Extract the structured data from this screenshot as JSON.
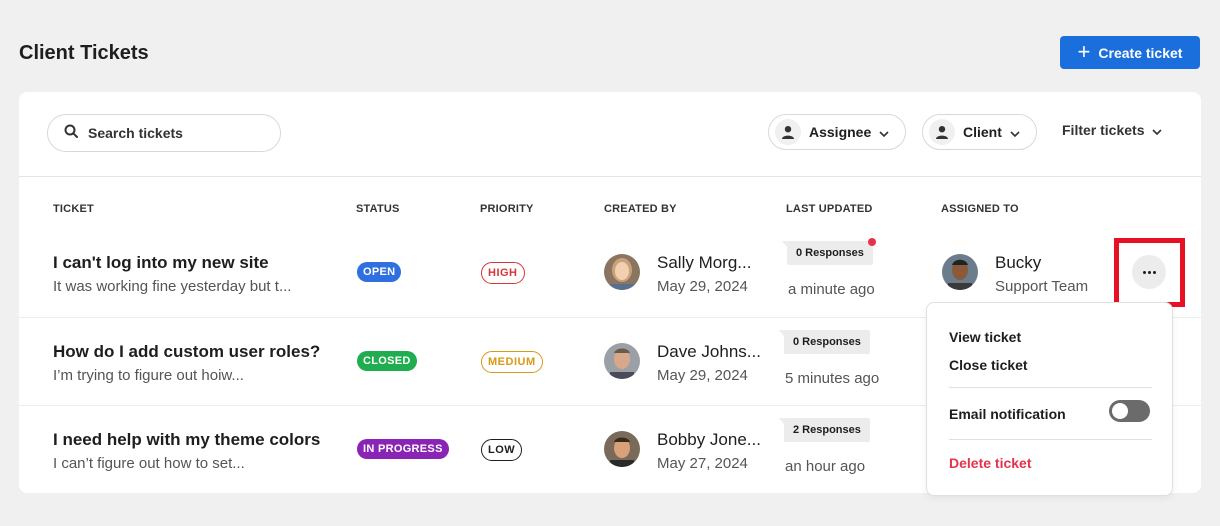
{
  "page": {
    "title": "Client Tickets",
    "create_label": "Create ticket"
  },
  "toolbar": {
    "search_placeholder": "Search tickets",
    "assignee_label": "Assignee",
    "client_label": "Client",
    "filter_label": "Filter tickets"
  },
  "columns": [
    "TICKET",
    "STATUS",
    "PRIORITY",
    "CREATED BY",
    "LAST UPDATED",
    "ASSIGNED TO"
  ],
  "tickets": [
    {
      "title": "I can't log into my new site",
      "desc": "It was working fine yesterday but t...",
      "status": "OPEN",
      "status_color": "#2f6fe0",
      "priority": "HIGH",
      "priority_color": "#d63638",
      "creator": "Sally Morg...",
      "created": "May 29, 2024",
      "responses": "0 Responses",
      "updated": "a minute ago",
      "assignee": "Bucky",
      "team": "Support Team"
    },
    {
      "title": "How do I add custom user roles?",
      "desc": "I’m trying to figure out hoiw...",
      "status": "CLOSED",
      "status_color": "#1fad4f",
      "priority": "MEDIUM",
      "priority_color": "#d69a14",
      "creator": "Dave Johns...",
      "created": "May 29, 2024",
      "responses": "0 Responses",
      "updated": "5 minutes ago"
    },
    {
      "title": "I need help with my theme colors",
      "desc": "I can’t figure out how to set...",
      "status": "IN PROGRESS",
      "status_color": "#8a24b5",
      "priority": "LOW",
      "priority_color": "#1e1e1e",
      "creator": "Bobby Jone...",
      "created": "May 27, 2024",
      "responses": "2 Responses",
      "updated": "an hour ago"
    }
  ],
  "menu": {
    "view": "View ticket",
    "close": "Close ticket",
    "email": "Email notification",
    "email_enabled": false,
    "delete": "Delete ticket"
  },
  "colors": {
    "accent": "#1a6fdc",
    "danger": "#e5334b",
    "highlight": "#e81123"
  }
}
